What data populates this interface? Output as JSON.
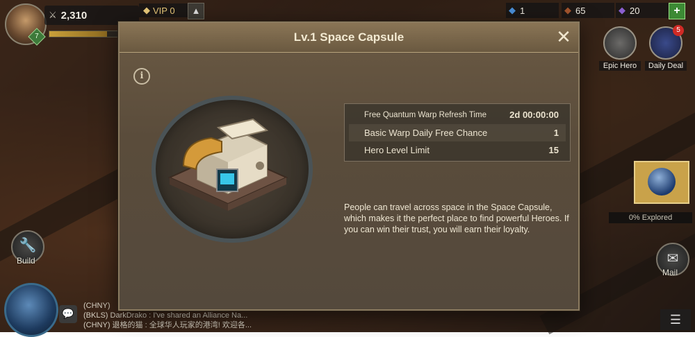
{
  "hud": {
    "power": "2,310",
    "level": "7",
    "xp_fraction": 0.75,
    "vip_label": "VIP 0",
    "resources": [
      {
        "name": "crystal",
        "value": "1",
        "color": "#4a8fd8"
      },
      {
        "name": "ore",
        "value": "65",
        "color": "#a4552e"
      },
      {
        "name": "gem",
        "value": "20",
        "color": "#8a5fd0"
      }
    ]
  },
  "side": {
    "epic_hero": "Epic Hero",
    "daily_deal": "Daily Deal",
    "daily_deal_badge": "5",
    "explored": "0% Explored",
    "build": "Build",
    "mail": "Mail"
  },
  "chat": {
    "lines": [
      "(CHNY)",
      "(BKLS) DarkDrako : I've shared an Alliance Na...",
      "(CHNY) 退格的猫 : 全球华人玩家的港湾! 欢迎各..."
    ]
  },
  "modal": {
    "title": "Lv.1 Space Capsule",
    "close": "✕",
    "info": "i",
    "stats": [
      {
        "label": "Free Quantum Warp Refresh Time",
        "value": "2d 00:00:00"
      },
      {
        "label": "Basic Warp Daily Free Chance",
        "value": "1"
      },
      {
        "label": "Hero Level Limit",
        "value": "15"
      }
    ],
    "description": "People can travel across space in the Space Capsule, which makes it the perfect place to find powerful Heroes. If you can win their trust, you will earn their loyalty."
  }
}
